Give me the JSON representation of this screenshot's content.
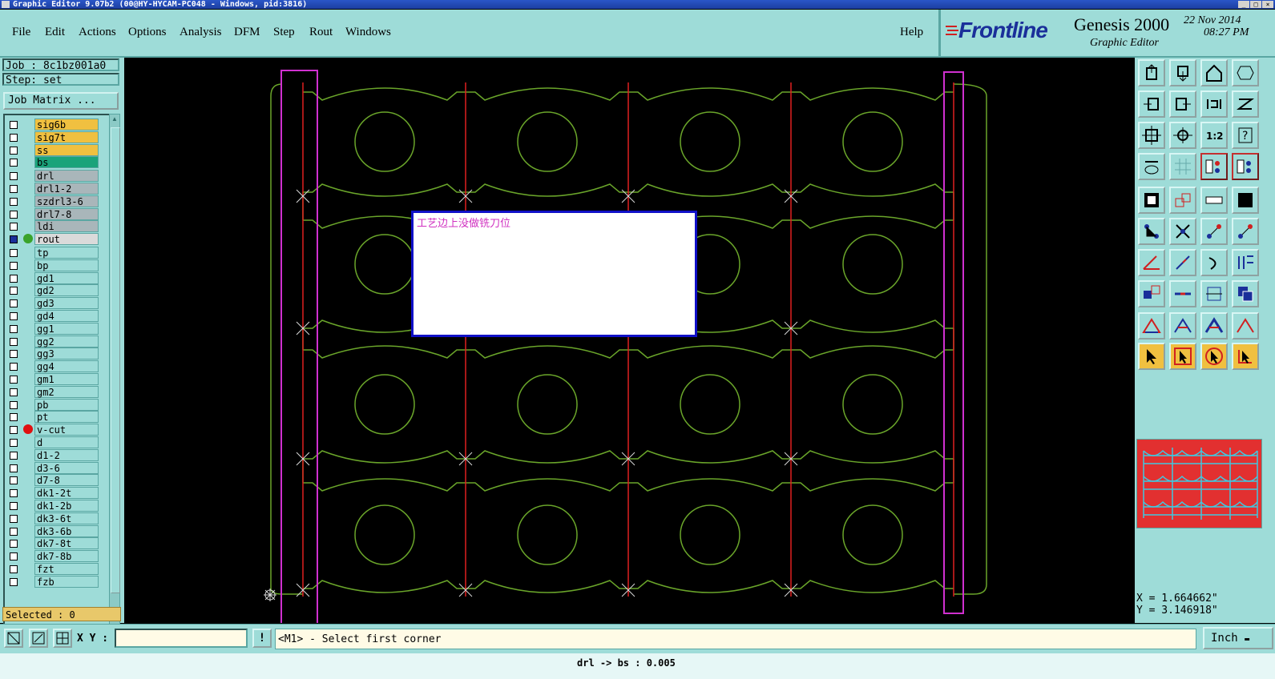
{
  "window": {
    "title": "Graphic Editor 9.07b2 (00@HY-HYCAM-PC048 - Windows, pid:3816)",
    "buttons": [
      "_",
      "□",
      "×"
    ]
  },
  "menu": {
    "items": [
      "File",
      "Edit",
      "Actions",
      "Options",
      "Analysis",
      "DFM",
      "Step",
      "Rout",
      "Windows"
    ],
    "help": "Help"
  },
  "brand": {
    "logo": "Frontline",
    "product": "Genesis 2000",
    "subtitle": "Graphic Editor",
    "date": "22 Nov 2014",
    "time": "08:27 PM"
  },
  "job": {
    "job_label": "Job : 8c1bz001a0",
    "step_label": "Step: set",
    "matrix_button": "Job Matrix ..."
  },
  "layers": [
    {
      "name": "sig6b",
      "color": "#f0c040",
      "group": 1
    },
    {
      "name": "sig7t",
      "color": "#f0c040",
      "group": 1
    },
    {
      "name": "ss",
      "color": "#f0c040",
      "group": 1
    },
    {
      "name": "bs",
      "color": "#1aa37a",
      "group": 1
    },
    {
      "name": "drl",
      "color": "#a9b6ba",
      "group": 2
    },
    {
      "name": "drl1-2",
      "color": "#a9b6ba",
      "group": 2
    },
    {
      "name": "szdrl3-6",
      "color": "#a9b6ba",
      "group": 2
    },
    {
      "name": "drl7-8",
      "color": "#a9b6ba",
      "group": 2
    },
    {
      "name": "ldi",
      "color": "#a9b6ba",
      "group": 2
    },
    {
      "name": "rout",
      "color": "#dadada",
      "group": 2,
      "active": true,
      "marker": "#3aa32a"
    },
    {
      "name": "tp",
      "color": "#9edcd8",
      "group": 3
    },
    {
      "name": "bp",
      "color": "#9edcd8",
      "group": 3
    },
    {
      "name": "gd1",
      "color": "#9edcd8",
      "group": 3
    },
    {
      "name": "gd2",
      "color": "#9edcd8",
      "group": 3
    },
    {
      "name": "gd3",
      "color": "#9edcd8",
      "group": 3
    },
    {
      "name": "gd4",
      "color": "#9edcd8",
      "group": 3
    },
    {
      "name": "gg1",
      "color": "#9edcd8",
      "group": 3
    },
    {
      "name": "gg2",
      "color": "#9edcd8",
      "group": 3
    },
    {
      "name": "gg3",
      "color": "#9edcd8",
      "group": 3
    },
    {
      "name": "gg4",
      "color": "#9edcd8",
      "group": 3
    },
    {
      "name": "gm1",
      "color": "#9edcd8",
      "group": 3
    },
    {
      "name": "gm2",
      "color": "#9edcd8",
      "group": 3
    },
    {
      "name": "pb",
      "color": "#9edcd8",
      "group": 3
    },
    {
      "name": "pt",
      "color": "#9edcd8",
      "group": 3
    },
    {
      "name": "v-cut",
      "color": "#9edcd8",
      "group": 3,
      "marker": "#e01010"
    },
    {
      "name": "d",
      "color": "#9edcd8",
      "group": 3
    },
    {
      "name": "d1-2",
      "color": "#9edcd8",
      "group": 3
    },
    {
      "name": "d3-6",
      "color": "#9edcd8",
      "group": 3
    },
    {
      "name": "d7-8",
      "color": "#9edcd8",
      "group": 3
    },
    {
      "name": "dk1-2t",
      "color": "#9edcd8",
      "group": 3
    },
    {
      "name": "dk1-2b",
      "color": "#9edcd8",
      "group": 3
    },
    {
      "name": "dk3-6t",
      "color": "#9edcd8",
      "group": 3
    },
    {
      "name": "dk3-6b",
      "color": "#9edcd8",
      "group": 3
    },
    {
      "name": "dk7-8t",
      "color": "#9edcd8",
      "group": 3
    },
    {
      "name": "dk7-8b",
      "color": "#9edcd8",
      "group": 3
    },
    {
      "name": "fzt",
      "color": "#9edcd8",
      "group": 3
    },
    {
      "name": "fzb",
      "color": "#9edcd8",
      "group": 3
    }
  ],
  "selected_label": "Selected : 0",
  "canvas": {
    "note_text": "工艺边上没做铣刀位",
    "colors": {
      "outline": "#6aa52a",
      "vcut": "#e02020",
      "frame": "#d030d0",
      "marker": "#d8d8d8"
    }
  },
  "coords": {
    "x": "X = 1.664662\"",
    "y": "Y = 3.146918\""
  },
  "bottom": {
    "xy_label": "X Y :",
    "xy_value": "",
    "info_btn": "!",
    "prompt": "<M1> - Select first corner",
    "units": "Inch"
  },
  "status": "drl -> bs : 0.005"
}
